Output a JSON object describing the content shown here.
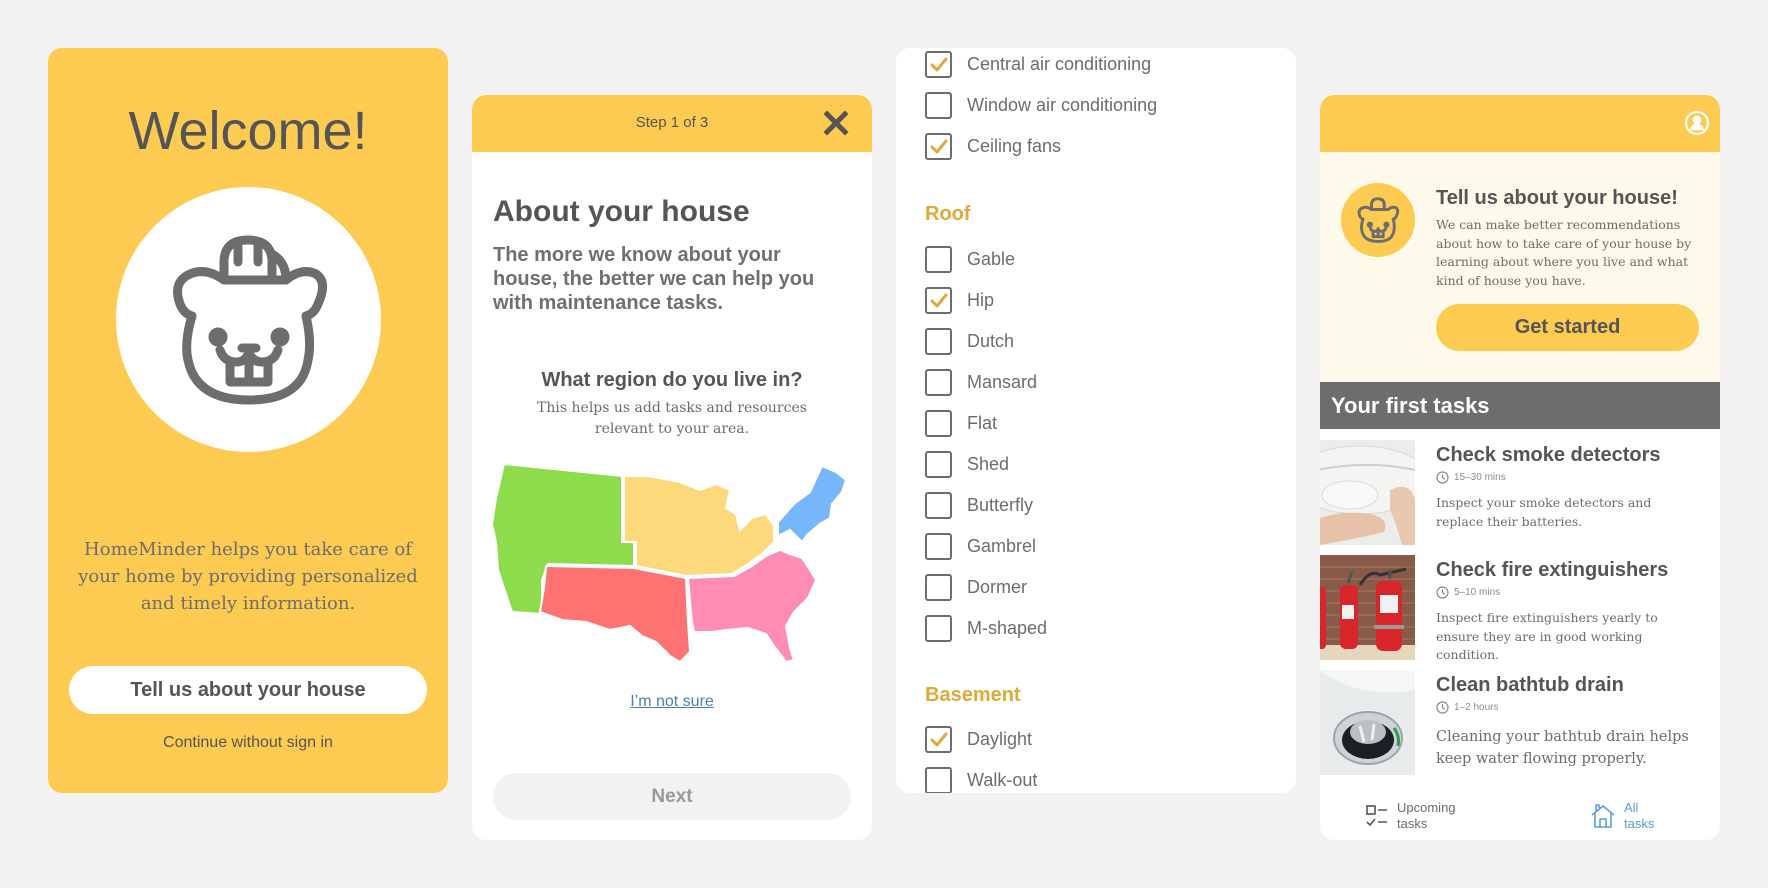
{
  "colors": {
    "brand_yellow": "#fecb52",
    "text_dark": "#555555",
    "text_mid": "#6d6d6d",
    "accent_gold": "#e0a93a",
    "link_blue": "#4a7ec4",
    "region_west": "#8ddc4c",
    "region_midwest": "#fed97b",
    "region_northeast": "#76b7fb",
    "region_southwest": "#fe7272",
    "region_southeast": "#fe8cb4"
  },
  "welcome": {
    "title": "Welcome!",
    "mascot_icon": "beaver-hardhat-icon",
    "description": "HomeMinder helps you take care of your home by providing personalized and timely information.",
    "primary_button": "Tell us about your house",
    "secondary_link": "Continue without sign in"
  },
  "about": {
    "step": "Step 1 of 3",
    "close_icon": "close-icon",
    "title": "About your house",
    "lead": "The more we know about your house, the better we can help you with maintenance tasks.",
    "question": "What region do you live in?",
    "question_sub": "This helps us add tasks and resources relevant to your area.",
    "regions": [
      "West",
      "Midwest",
      "Northeast",
      "Southwest",
      "Southeast"
    ],
    "not_sure_link": "I’m not sure",
    "next_button": "Next"
  },
  "features": {
    "cooling": [
      {
        "label": "Central air conditioning",
        "checked": true
      },
      {
        "label": "Window air conditioning",
        "checked": false
      },
      {
        "label": "Ceiling fans",
        "checked": true
      }
    ],
    "roof_title": "Roof",
    "roof": [
      {
        "label": "Gable",
        "checked": false
      },
      {
        "label": "Hip",
        "checked": true
      },
      {
        "label": "Dutch",
        "checked": false
      },
      {
        "label": "Mansard",
        "checked": false
      },
      {
        "label": "Flat",
        "checked": false
      },
      {
        "label": "Shed",
        "checked": false
      },
      {
        "label": "Butterfly",
        "checked": false
      },
      {
        "label": "Gambrel",
        "checked": false
      },
      {
        "label": "Dormer",
        "checked": false
      },
      {
        "label": "M-shaped",
        "checked": false
      }
    ],
    "basement_title": "Basement",
    "basement": [
      {
        "label": "Daylight",
        "checked": true
      },
      {
        "label": "Walk-out",
        "checked": false
      }
    ]
  },
  "home": {
    "user_icon": "user-profile-icon",
    "promo": {
      "title": "Tell us about your house!",
      "body": "We can make better recommendations about how to take care of your house by learning about where you live and what kind of house you have.",
      "button": "Get started"
    },
    "tasks_title": "Your first tasks",
    "tasks": [
      {
        "title": "Check smoke detectors",
        "duration": "15–30 mins",
        "description": "Inspect your smoke detectors and replace their batteries.",
        "image": "smoke-detector-photo"
      },
      {
        "title": "Check fire extinguishers",
        "duration": "5–10 mins",
        "description": "Inspect fire extinguishers yearly to ensure they are in good working condition.",
        "image": "fire-extinguishers-photo"
      },
      {
        "title": "Clean bathtub drain",
        "duration": "1–2 hours",
        "description": "Cleaning your bathtub drain helps keep water flowing properly.",
        "image": "bathtub-drain-photo"
      }
    ],
    "nav": [
      {
        "label_line1": "Upcoming",
        "label_line2": "tasks",
        "icon": "checklist-icon",
        "active": false
      },
      {
        "label_line1": "All",
        "label_line2": "tasks",
        "icon": "home-icon",
        "active": true
      }
    ]
  }
}
